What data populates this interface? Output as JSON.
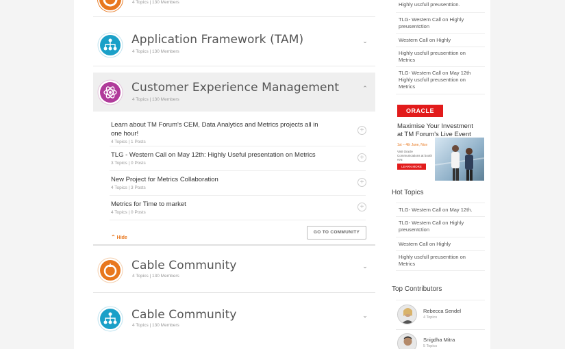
{
  "communities": [
    {
      "title": "",
      "meta": "4 Topics | 130 Members",
      "icon": "flame-icon",
      "color": "#e8771e"
    },
    {
      "title": "Application Framework (TAM)",
      "meta": "4 Topics | 130 Members",
      "icon": "network-icon",
      "color": "#1aa0c8"
    },
    {
      "title": "Customer Experience Management",
      "meta": "4 Topics | 130 Members",
      "icon": "atom-icon",
      "color": "#b03a9a"
    },
    {
      "title": "Cable Community",
      "meta": "4 Topics | 130 Members",
      "icon": "flame-icon",
      "color": "#e8771e"
    },
    {
      "title": "Cable Community",
      "meta": "4 Topics | 130 Members",
      "icon": "network-icon",
      "color": "#1aa0c8"
    }
  ],
  "topics": [
    {
      "title": "Learn about TM Forum's CEM, Data Analytics and Metrics projects all in one hour!",
      "meta": "4 Topics | 1 Posts"
    },
    {
      "title": "TLG - Western Call on May 12th: Highly Useful presentation on Metrics",
      "meta": "3 Topics | 0 Posts"
    },
    {
      "title": "New Project for Metrics Collaboration",
      "meta": "4 Topics | 3 Posts"
    },
    {
      "title": "Metrics for Time to market",
      "meta": "4 Topics | 0 Posts"
    }
  ],
  "actions": {
    "goto": "GO TO COMMUNITY",
    "hide": "Hide"
  },
  "sidebar": {
    "top_links": [
      "Highly uscfull preusenttion.",
      "TLG- Western Call on Highly preusentction",
      "Western Call on Highly",
      "Highly uscfull preusenttion on Metrics",
      "TLG- Western Call on May 12th Highly uscfull preusenttion on Metrics"
    ],
    "ad": {
      "brand": "ORACLE",
      "line1": "Maximise Your Investment",
      "line2": "at TM Forum's Live Event",
      "dates": "1st – 4th June, Nice",
      "venue": "Visit Oracle Communications at booth #78",
      "button": "LEARN MORE"
    },
    "hot_topics_heading": "Hot Topics",
    "hot_topics": [
      "TLG- Western Call on May 12th.",
      "TLG- Western Call on Highly preusentction",
      "Western Call on Highly",
      "Highly uscfull preusenttion on Metrics"
    ],
    "contributors_heading": "Top Contributors",
    "contributors": [
      {
        "name": "Rebecca Sendel",
        "sub": "4 Topics"
      },
      {
        "name": "Snigdha Mitra",
        "sub": "5 Topics"
      }
    ]
  }
}
